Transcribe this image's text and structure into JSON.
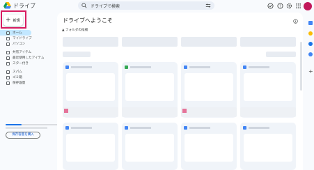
{
  "header": {
    "app_title": "ドライブ",
    "search_placeholder": "ドライブで検索"
  },
  "sidebar": {
    "new_label": "新規",
    "items": [
      {
        "label": "ホーム",
        "icon": "home-icon",
        "active": true
      },
      {
        "label": "マイドライブ",
        "icon": "drive-icon"
      },
      {
        "label": "パソコン",
        "icon": "computer-icon"
      },
      {
        "label": "共有アイテム",
        "icon": "shared-icon"
      },
      {
        "label": "最近使用したアイテム",
        "icon": "clock-icon"
      },
      {
        "label": "スター付き",
        "icon": "star-icon"
      },
      {
        "label": "スパム",
        "icon": "spam-icon"
      },
      {
        "label": "ゴミ箱",
        "icon": "trash-icon"
      },
      {
        "label": "保存容量",
        "icon": "cloud-icon"
      }
    ],
    "buy_storage_label": "保存容量を購入"
  },
  "main": {
    "welcome": "ドライブへようこそ",
    "section_label": "フォルダの候補"
  },
  "colors": {
    "accent": "#0b57d0",
    "active_nav": "#c2e7ff",
    "highlight_box": "#d81b60",
    "avatar": "#c2185b"
  }
}
